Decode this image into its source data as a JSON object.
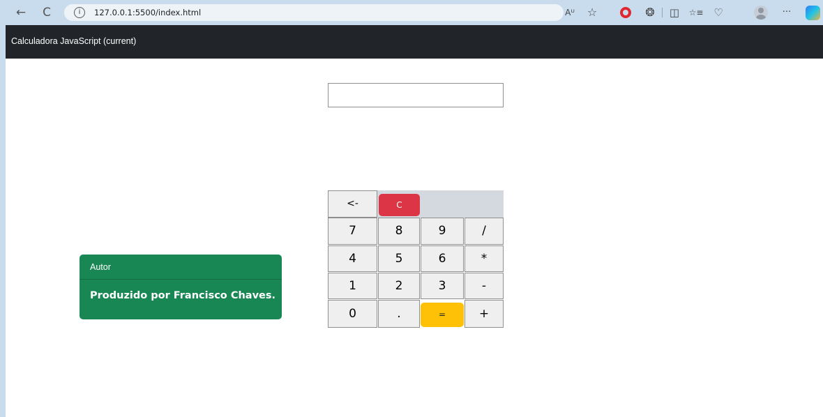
{
  "browser": {
    "url": "127.0.0.1:5500/index.html",
    "icons": [
      "back-icon",
      "refresh-icon",
      "info-icon",
      "read-aloud-icon",
      "favorite-star-icon",
      "opera-icon",
      "extensions-icon",
      "split-screen-icon",
      "favorites-icon",
      "browser-essentials-icon",
      "profile-avatar-icon",
      "more-icon",
      "copilot-icon"
    ],
    "back_glyph": "←",
    "refresh_glyph": "C",
    "info_glyph": "i",
    "read_aloud_glyph": "Aᵁ",
    "star_glyph": "☆",
    "extensions_glyph": "❂",
    "split_glyph": "◫",
    "favorites_glyph": "☆≡",
    "essentials_glyph": "♡",
    "more_glyph": "···"
  },
  "navbar": {
    "brand": "Calculadora JavaScript (current)",
    "background": "#212529"
  },
  "calculator": {
    "display_value": "",
    "backspace_label": "<-",
    "clear_label": "C",
    "clear_color": "#dc3545",
    "equals_label": "=",
    "equals_color": "#ffc107",
    "rows": [
      [
        "7",
        "8",
        "9",
        "/"
      ],
      [
        "4",
        "5",
        "6",
        "*"
      ],
      [
        "1",
        "2",
        "3",
        "-"
      ],
      [
        "0",
        ".",
        "=",
        "+"
      ]
    ]
  },
  "card": {
    "header": "Autor",
    "title": "Produzido por Francisco Chaves.",
    "background": "#198754"
  }
}
